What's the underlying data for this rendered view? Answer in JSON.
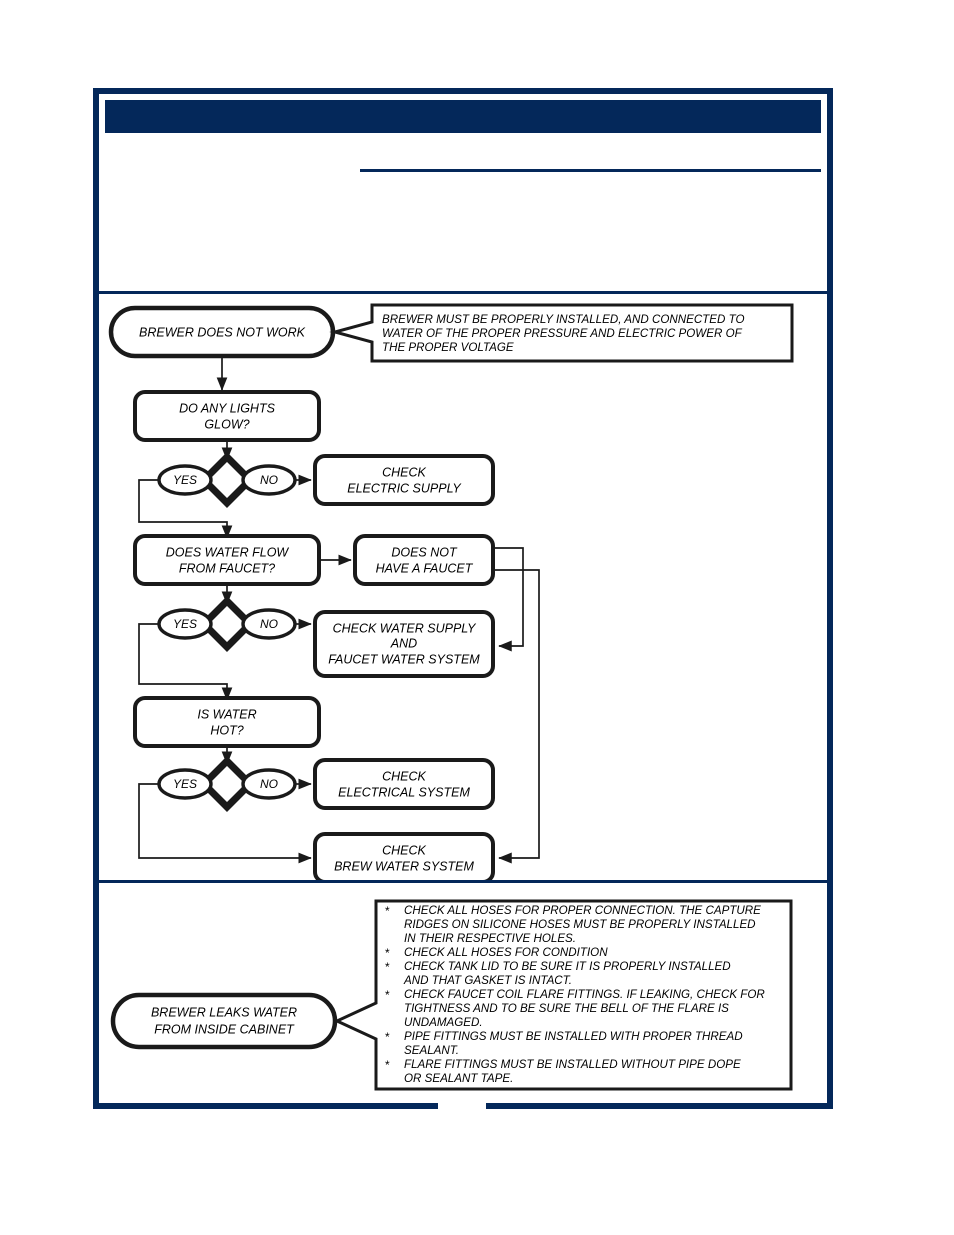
{
  "header": {
    "title": "",
    "subtitle": "",
    "note": ""
  },
  "flow": {
    "start_node": "BREWER DOES NOT WORK",
    "start_callout": [
      "BREWER MUST BE PROPERLY INSTALLED, AND CONNECTED TO",
      "WATER OF THE PROPER PRESSURE AND ELECTRIC POWER OF",
      "THE PROPER VOLTAGE"
    ],
    "q1": [
      "DO ANY LIGHTS",
      "GLOW?"
    ],
    "q1_yes": "YES",
    "q1_no": "NO",
    "q1_no_action": [
      "CHECK",
      "ELECTRIC SUPPLY"
    ],
    "q2": [
      "DOES WATER FLOW",
      "FROM FAUCET?"
    ],
    "q2_side": [
      "DOES NOT",
      "HAVE A FAUCET"
    ],
    "q2_yes": "YES",
    "q2_no": "NO",
    "q2_no_action": [
      "CHECK WATER SUPPLY",
      "AND",
      "FAUCET  WATER SYSTEM"
    ],
    "q3": [
      "IS WATER",
      "HOT?"
    ],
    "q3_yes": "YES",
    "q3_no": "NO",
    "q3_no_action": [
      "CHECK",
      "ELECTRICAL SYSTEM"
    ],
    "final_action": [
      "CHECK",
      "BREW WATER SYSTEM"
    ]
  },
  "leak": {
    "node": [
      "BREWER LEAKS WATER",
      "FROM INSIDE CABINET"
    ],
    "bullet_marker": "*",
    "items": [
      [
        "CHECK ALL HOSES FOR PROPER CONNECTION.  THE CAPTURE",
        "RIDGES ON SILICONE HOSES MUST BE PROPERLY INSTALLED",
        "IN THEIR RESPECTIVE HOLES."
      ],
      [
        "CHECK ALL HOSES FOR CONDITION"
      ],
      [
        "CHECK TANK LID TO BE SURE IT IS PROPERLY INSTALLED",
        " AND THAT GASKET IS INTACT."
      ],
      [
        "CHECK FAUCET COIL FLARE FITTINGS.  IF LEAKING, CHECK FOR",
        "TIGHTNESS AND TO BE SURE THE BELL OF THE FLARE IS",
        " UNDAMAGED."
      ],
      [
        " PIPE FITTINGS MUST BE INSTALLED WITH PROPER THREAD",
        " SEALANT."
      ],
      [
        " FLARE FITTINGS MUST BE INSTALLED WITHOUT PIPE DOPE",
        " OR SEALANT TAPE."
      ]
    ]
  },
  "footer": {
    "page_number": ""
  },
  "colors": {
    "navy": "#04285a",
    "ink": "#1a1a1a",
    "paper": "#ffffff"
  }
}
